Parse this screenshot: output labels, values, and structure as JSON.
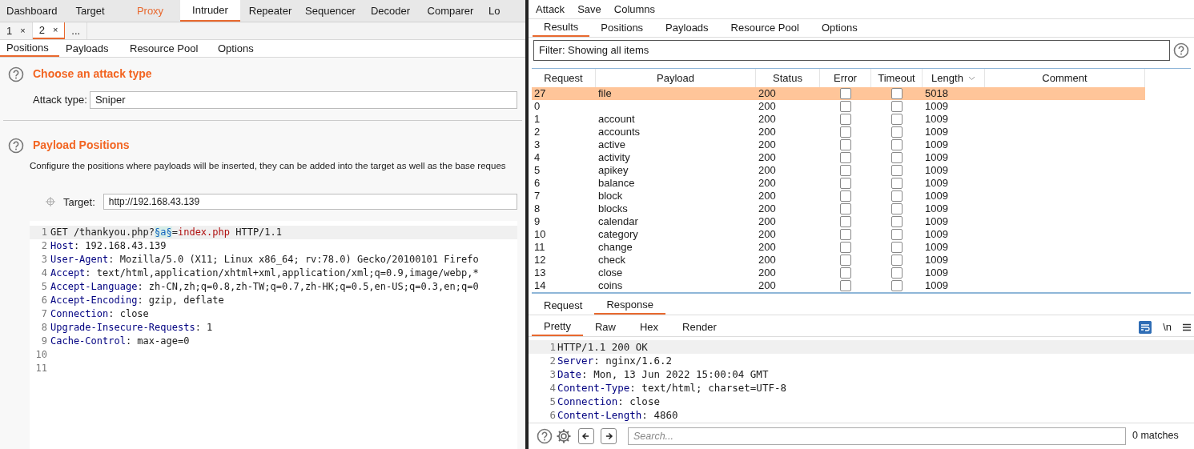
{
  "left": {
    "main_tabs": [
      {
        "label": "Dashboard",
        "selected": false,
        "highlighted": false
      },
      {
        "label": "Target",
        "selected": false,
        "highlighted": false
      },
      {
        "label": "Proxy",
        "selected": false,
        "highlighted": true
      },
      {
        "label": "Intruder",
        "selected": true,
        "highlighted": false
      },
      {
        "label": "Repeater",
        "selected": false,
        "highlighted": false
      },
      {
        "label": "Sequencer",
        "selected": false,
        "highlighted": false
      },
      {
        "label": "Decoder",
        "selected": false,
        "highlighted": false
      },
      {
        "label": "Comparer",
        "selected": false,
        "highlighted": false
      },
      {
        "label": "Lo",
        "selected": false,
        "highlighted": false
      }
    ],
    "attack_tabs": [
      {
        "label": "1",
        "close": "×",
        "selected": false
      },
      {
        "label": "2",
        "close": "×",
        "selected": true
      },
      {
        "label": "...",
        "selected": false
      }
    ],
    "sub_tabs": [
      {
        "label": "Positions",
        "selected": true
      },
      {
        "label": "Payloads",
        "selected": false
      },
      {
        "label": "Resource Pool",
        "selected": false
      },
      {
        "label": "Options",
        "selected": false
      }
    ],
    "attack_type_section": {
      "title": "Choose an attack type",
      "label": "Attack type:",
      "value": "Sniper"
    },
    "payload_positions": {
      "title": "Payload Positions",
      "description": "Configure the positions where payloads will be inserted, they can be added into the target as well as the base reques",
      "target_label": "Target:",
      "target_value": "http://192.168.43.139",
      "lines": [
        {
          "number": "1",
          "kind": "request",
          "text": "GET /thankyou.php?",
          "marker": "§a§",
          "sep": "=",
          "value": "index.php",
          "tail": " HTTP/1.1"
        },
        {
          "number": "2",
          "kind": "header",
          "name": "Host",
          "sep": ":",
          "value": "192.168.43.139"
        },
        {
          "number": "3",
          "kind": "header",
          "name": "User-Agent",
          "sep": ":",
          "value": "Mozilla/5.0 (X11; Linux x86_64; rv:78.0) Gecko/20100101 Firefo"
        },
        {
          "number": "4",
          "kind": "header",
          "name": "Accept",
          "sep": ":",
          "value": "text/html,application/xhtml+xml,application/xml;q=0.9,image/webp,*"
        },
        {
          "number": "5",
          "kind": "header",
          "name": "Accept-Language",
          "sep": ":",
          "value": "zh-CN,zh;q=0.8,zh-TW;q=0.7,zh-HK;q=0.5,en-US;q=0.3,en;q=0"
        },
        {
          "number": "6",
          "kind": "header",
          "name": "Accept-Encoding",
          "sep": ":",
          "value": "gzip, deflate"
        },
        {
          "number": "7",
          "kind": "header",
          "name": "Connection",
          "sep": ":",
          "value": "close"
        },
        {
          "number": "8",
          "kind": "header",
          "name": "Upgrade-Insecure-Requests",
          "sep": ":",
          "value": "1"
        },
        {
          "number": "9",
          "kind": "header",
          "name": "Cache-Control",
          "sep": ":",
          "value": "max-age=0"
        },
        {
          "number": "10",
          "kind": "empty"
        },
        {
          "number": "11",
          "kind": "empty"
        }
      ]
    }
  },
  "right": {
    "menu": [
      "Attack",
      "Save",
      "Columns"
    ],
    "tabs": [
      {
        "label": "Results",
        "selected": true
      },
      {
        "label": "Positions",
        "selected": false
      },
      {
        "label": "Payloads",
        "selected": false
      },
      {
        "label": "Resource Pool",
        "selected": false
      },
      {
        "label": "Options",
        "selected": false
      }
    ],
    "filter": "Filter: Showing all items",
    "table": {
      "columns": [
        "Request",
        "Payload",
        "Status",
        "Error",
        "Timeout",
        "Length",
        "Comment"
      ],
      "rows": [
        {
          "request": "27",
          "payload": "file",
          "status": "200",
          "error": false,
          "timeout": false,
          "length": "5018",
          "selected": true
        },
        {
          "request": "0",
          "payload": "",
          "status": "200",
          "error": false,
          "timeout": false,
          "length": "1009",
          "selected": false
        },
        {
          "request": "1",
          "payload": "account",
          "status": "200",
          "error": false,
          "timeout": false,
          "length": "1009",
          "selected": false
        },
        {
          "request": "2",
          "payload": "accounts",
          "status": "200",
          "error": false,
          "timeout": false,
          "length": "1009",
          "selected": false
        },
        {
          "request": "3",
          "payload": "active",
          "status": "200",
          "error": false,
          "timeout": false,
          "length": "1009",
          "selected": false
        },
        {
          "request": "4",
          "payload": "activity",
          "status": "200",
          "error": false,
          "timeout": false,
          "length": "1009",
          "selected": false
        },
        {
          "request": "5",
          "payload": "apikey",
          "status": "200",
          "error": false,
          "timeout": false,
          "length": "1009",
          "selected": false
        },
        {
          "request": "6",
          "payload": "balance",
          "status": "200",
          "error": false,
          "timeout": false,
          "length": "1009",
          "selected": false
        },
        {
          "request": "7",
          "payload": "block",
          "status": "200",
          "error": false,
          "timeout": false,
          "length": "1009",
          "selected": false
        },
        {
          "request": "8",
          "payload": "blocks",
          "status": "200",
          "error": false,
          "timeout": false,
          "length": "1009",
          "selected": false
        },
        {
          "request": "9",
          "payload": "calendar",
          "status": "200",
          "error": false,
          "timeout": false,
          "length": "1009",
          "selected": false
        },
        {
          "request": "10",
          "payload": "category",
          "status": "200",
          "error": false,
          "timeout": false,
          "length": "1009",
          "selected": false
        },
        {
          "request": "11",
          "payload": "change",
          "status": "200",
          "error": false,
          "timeout": false,
          "length": "1009",
          "selected": false
        },
        {
          "request": "12",
          "payload": "check",
          "status": "200",
          "error": false,
          "timeout": false,
          "length": "1009",
          "selected": false
        },
        {
          "request": "13",
          "payload": "close",
          "status": "200",
          "error": false,
          "timeout": false,
          "length": "1009",
          "selected": false
        },
        {
          "request": "14",
          "payload": "coins",
          "status": "200",
          "error": false,
          "timeout": false,
          "length": "1009",
          "selected": false
        }
      ]
    },
    "message_tabs": [
      {
        "label": "Request",
        "selected": false
      },
      {
        "label": "Response",
        "selected": true
      }
    ],
    "view_tabs": [
      {
        "label": "Pretty",
        "selected": true
      },
      {
        "label": "Raw",
        "selected": false
      },
      {
        "label": "Hex",
        "selected": false
      },
      {
        "label": "Render",
        "selected": false
      }
    ],
    "newline_toggle": "\\n",
    "wrap_on": true,
    "response_lines": [
      {
        "number": "1",
        "kind": "status",
        "text": "HTTP/1.1 200 OK"
      },
      {
        "number": "2",
        "kind": "header",
        "name": "Server",
        "sep": ":",
        "value": "nginx/1.6.2"
      },
      {
        "number": "3",
        "kind": "header",
        "name": "Date",
        "sep": ":",
        "value": "Mon, 13 Jun 2022 15:00:04 GMT"
      },
      {
        "number": "4",
        "kind": "header",
        "name": "Content-Type",
        "sep": ":",
        "value": "text/html; charset=UTF-8"
      },
      {
        "number": "5",
        "kind": "header",
        "name": "Connection",
        "sep": ":",
        "value": "close"
      },
      {
        "number": "6",
        "kind": "header",
        "name": "Content-Length",
        "sep": ":",
        "value": "4860"
      }
    ],
    "search": {
      "placeholder": "Search...",
      "matches": "0 matches"
    }
  }
}
